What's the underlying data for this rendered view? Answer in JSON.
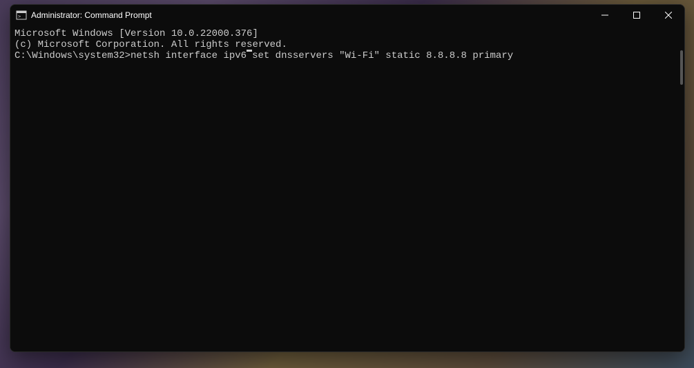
{
  "titlebar": {
    "title": "Administrator: Command Prompt"
  },
  "terminal": {
    "line1": "Microsoft Windows [Version 10.0.22000.376]",
    "line2": "(c) Microsoft Corporation. All rights reserved.",
    "blank": "",
    "prompt": "C:\\Windows\\system32>",
    "command_before_cursor": "netsh interface ipv6",
    "command_after_cursor": "set dnsservers \"Wi-Fi\" static 8.8.8.8 primary"
  }
}
